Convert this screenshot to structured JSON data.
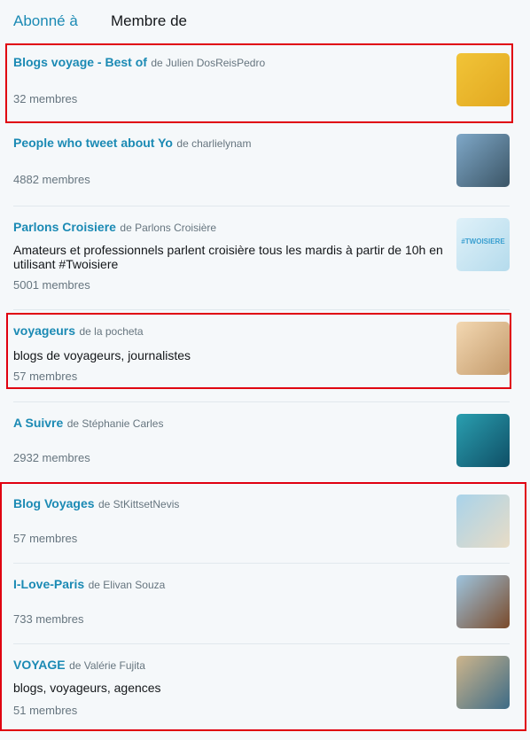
{
  "tabs": {
    "following": "Abonné à",
    "member_of": "Membre de"
  },
  "lists": [
    {
      "name": "Blogs voyage - Best of",
      "by": "de Julien DosReisPedro",
      "desc": "",
      "count": "32 membres",
      "thumb_colors": [
        "#f1c438",
        "#e2a820"
      ]
    },
    {
      "name": "People who tweet about Yo",
      "by": "de charlielynam",
      "desc": "",
      "count": "4882 membres",
      "thumb_colors": [
        "#7fa8c8",
        "#3b5566"
      ]
    },
    {
      "name": "Parlons Croisiere",
      "by": "de Parlons Croisière",
      "desc": "Amateurs et professionnels parlent croisière tous les mardis à partir de 10h en utilisant #Twoisiere",
      "count": "5001 membres",
      "thumb_colors": [
        "#dff1f9",
        "#b5dbec"
      ],
      "thumb_text": "#TWOISIERE"
    },
    {
      "name": "voyageurs",
      "by": "de la pocheta",
      "desc": "blogs de voyageurs, journalistes",
      "count": "57 membres",
      "thumb_colors": [
        "#f3d8b2",
        "#c39a6b"
      ]
    },
    {
      "name": "A Suivre",
      "by": "de Stéphanie Carles",
      "desc": "",
      "count": "2932 membres",
      "thumb_colors": [
        "#2a9fb0",
        "#0f4f66"
      ]
    },
    {
      "name": "Blog Voyages",
      "by": "de StKittsetNevis",
      "desc": "",
      "count": "57 membres",
      "thumb_colors": [
        "#a9d3ea",
        "#e8dcc6"
      ]
    },
    {
      "name": "I-Love-Paris",
      "by": "de Elivan Souza",
      "desc": "",
      "count": "733 membres",
      "thumb_colors": [
        "#9ec4de",
        "#7a4a2a"
      ]
    },
    {
      "name": "VOYAGE",
      "by": "de Valérie Fujita",
      "desc": "blogs, voyageurs, agences",
      "count": "51 membres",
      "thumb_colors": [
        "#cdb58c",
        "#3d6b86"
      ]
    }
  ]
}
